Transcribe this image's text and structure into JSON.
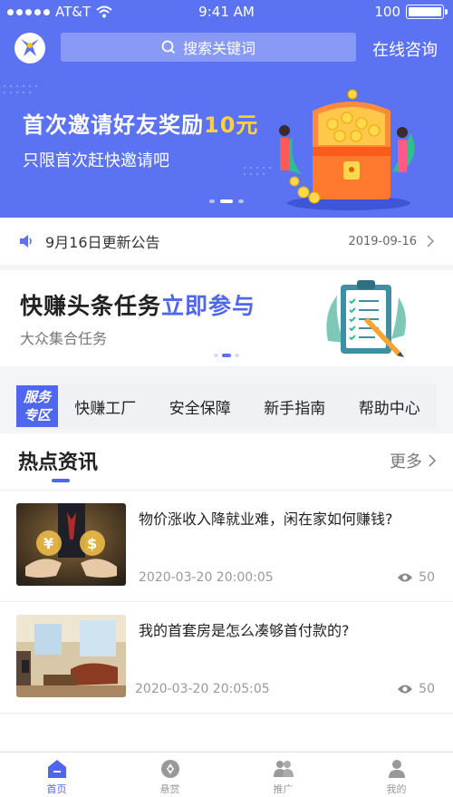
{
  "status_bar": {
    "carrier": "AT&T",
    "time": "9:41 AM",
    "battery": "100"
  },
  "header": {
    "search_placeholder": "搜索关键词",
    "consult_label": "在线咨询"
  },
  "banner": {
    "line1_prefix": "首次邀请好友奖励",
    "line1_amount": "10元",
    "line2": "只限首次赶快邀请吧",
    "accent": "#ffd23a"
  },
  "notice": {
    "title": "9月16日更新公告",
    "date": "2019-09-16"
  },
  "task_card": {
    "headline_dark": "快赚头条任务",
    "headline_blue": "立即参与",
    "subtitle": "大众集合任务"
  },
  "service": {
    "badge_line1": "服务",
    "badge_line2": "专区",
    "items": [
      "快赚工厂",
      "安全保障",
      "新手指南",
      "帮助中心"
    ]
  },
  "news": {
    "title": "热点资讯",
    "more": "更多",
    "items": [
      {
        "title": "物价涨收入降就业难，闲在家如何赚钱?",
        "time": "2020-03-20  20:00:05",
        "views": "50"
      },
      {
        "title": "我的首套房是怎么凑够首付款的?",
        "time": "2020-03-20  20:05:05",
        "views": "50"
      }
    ]
  },
  "tabbar": {
    "tabs": [
      "首页",
      "悬赏",
      "推广",
      "我的"
    ]
  },
  "colors": {
    "primary": "#5b73f2",
    "brand_blue": "#4f67ee"
  }
}
